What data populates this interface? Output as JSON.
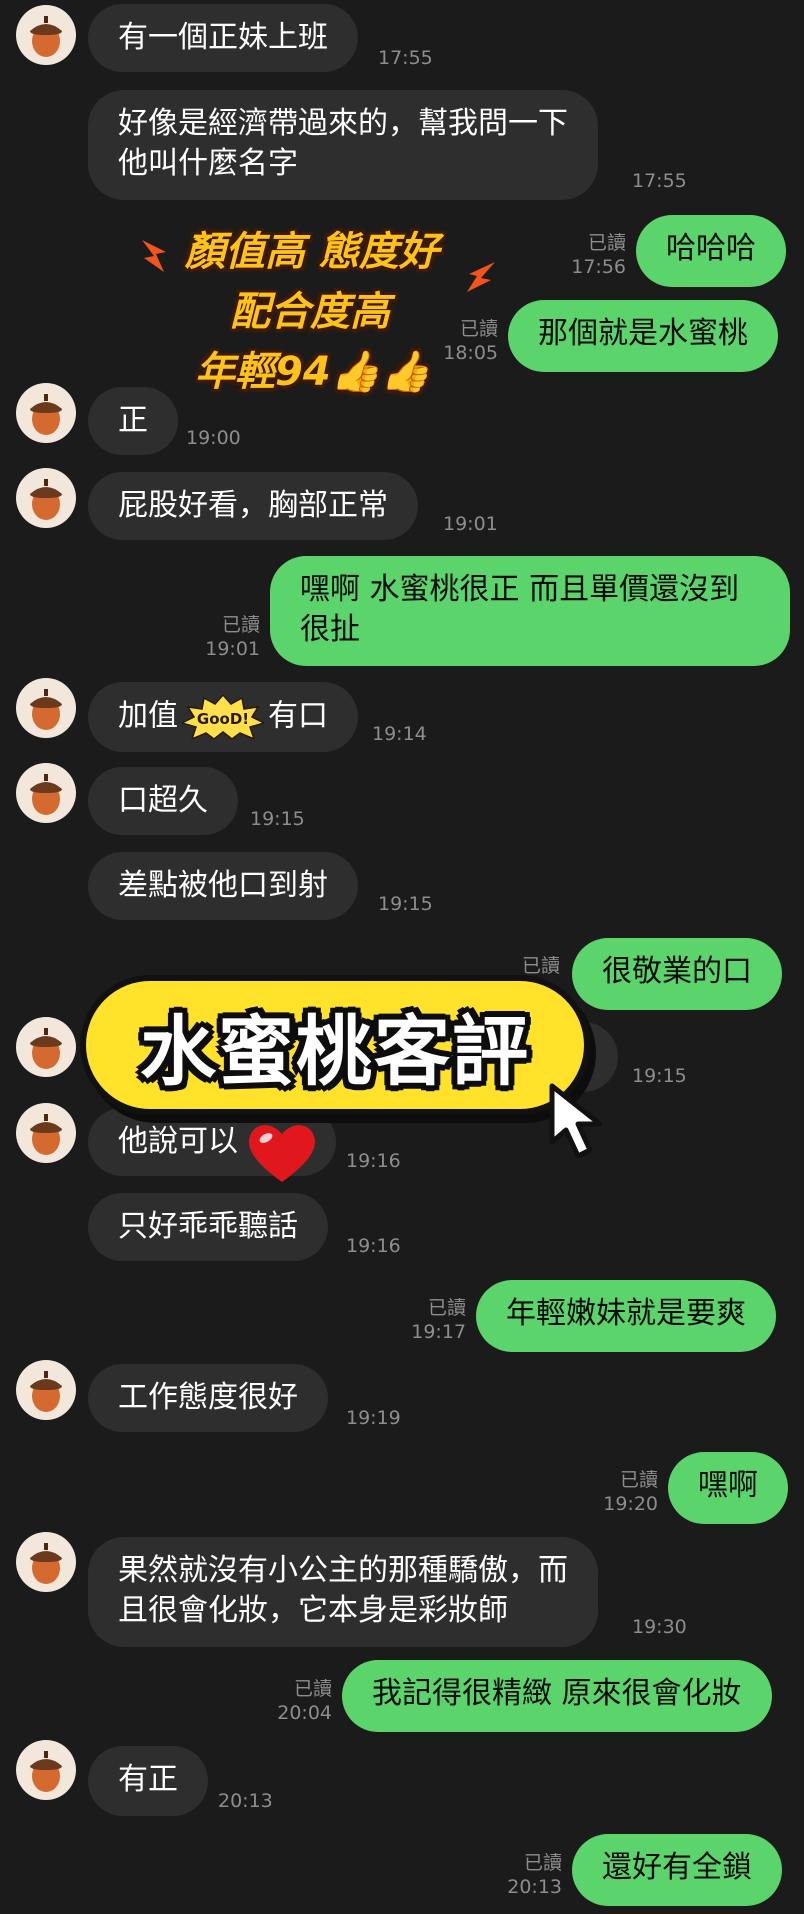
{
  "chat": {
    "read_label": "已讀",
    "messages": [
      {
        "side": "in",
        "text": "有一個正妹上班",
        "time": "17:55"
      },
      {
        "side": "in",
        "text_lines": [
          "好像是經濟帶過來的，幫我問一下",
          "他叫什麼名字"
        ],
        "time": "17:55"
      },
      {
        "side": "out",
        "text": "哈哈哈",
        "time": "17:56"
      },
      {
        "side": "out",
        "text": "那個就是水蜜桃",
        "time": "18:05"
      },
      {
        "side": "in",
        "text": "正",
        "time": "19:00"
      },
      {
        "side": "in",
        "text": "屁股好看，胸部正常",
        "time": "19:01"
      },
      {
        "side": "out",
        "text_lines": [
          "嘿啊 水蜜桃很正 而且單價還沒到",
          "很扯"
        ],
        "time": "19:01"
      },
      {
        "side": "in",
        "text_before": "加值",
        "sticker_text": "GooD!",
        "text_after": "有口",
        "time": "19:14"
      },
      {
        "side": "in",
        "text": "口超久",
        "time": "19:15"
      },
      {
        "side": "in",
        "text": "差點被他口到射",
        "time": "19:15"
      },
      {
        "side": "out",
        "text": "很敬業的口",
        "time": ""
      },
      {
        "side": "in",
        "text": "",
        "time": "19:15"
      },
      {
        "side": "in",
        "text": "他說可以",
        "time": "19:16"
      },
      {
        "side": "in",
        "text": "只好乖乖聽話",
        "time": "19:16"
      },
      {
        "side": "out",
        "text": "年輕嫩妹就是要爽",
        "time": "19:17"
      },
      {
        "side": "in",
        "text": "工作態度很好",
        "time": "19:19"
      },
      {
        "side": "out",
        "text": "嘿啊",
        "time": "19:20"
      },
      {
        "side": "in",
        "text_lines": [
          "果然就沒有小公主的那種驕傲，而",
          "且很會化妝，它本身是彩妝師"
        ],
        "time": "19:30"
      },
      {
        "side": "out",
        "text": "我記得很精緻 原來很會化妝",
        "time": "20:04"
      },
      {
        "side": "in",
        "text": "有正",
        "time": "20:13"
      },
      {
        "side": "out",
        "text": "還好有全鎖",
        "time": "20:13"
      }
    ]
  },
  "overlay": {
    "promo_lines": [
      "顏值高 態度好",
      "配合度高",
      "年輕94👍👍"
    ],
    "banner_title": "水蜜桃客評"
  },
  "colors": {
    "background": "#1b1b1b",
    "incoming_bubble": "#2e2e2e",
    "outgoing_bubble": "#5ad46b",
    "banner": "#ffe229",
    "promo_text": "#ffc219"
  }
}
